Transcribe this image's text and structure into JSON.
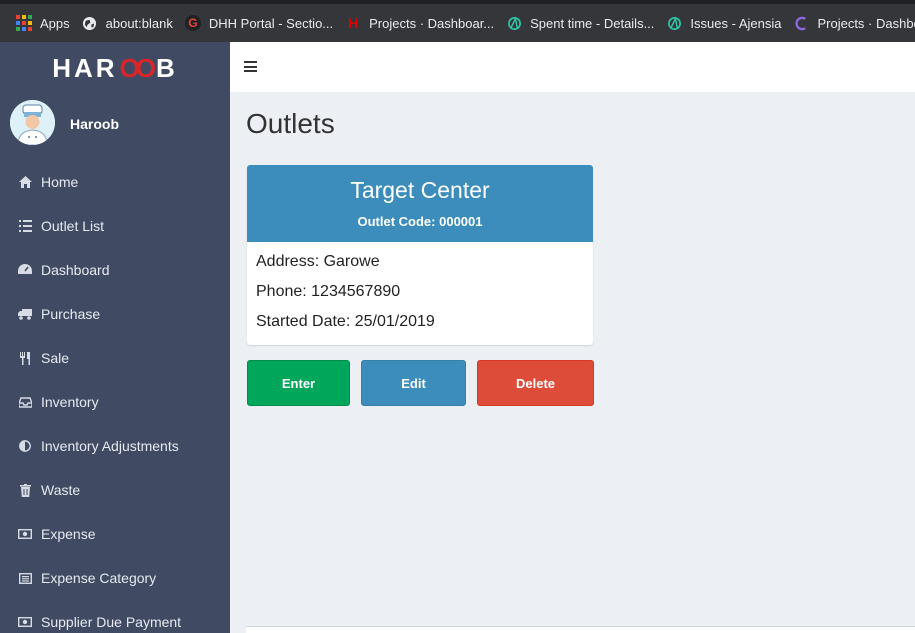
{
  "bookmarks": [
    {
      "icon": "apps-grid-icon",
      "label": "Apps"
    },
    {
      "icon": "globe-icon",
      "label": "about:blank"
    },
    {
      "icon": "g-logo-icon",
      "label": "DHH Portal - Sectio..."
    },
    {
      "icon": "h-logo-icon",
      "label": "Projects · Dashboar..."
    },
    {
      "icon": "ajensia-icon",
      "label": "Spent time - Details..."
    },
    {
      "icon": "ajensia-icon",
      "label": "Issues - Ajensia"
    },
    {
      "icon": "c-logo-icon",
      "label": "Projects · Dashboar..."
    }
  ],
  "brand": {
    "part1": "HAR",
    "part2": "OO",
    "part3": "B",
    "accent": "#d9252a"
  },
  "user": {
    "name": "Haroob"
  },
  "menu": [
    {
      "icon": "home-icon",
      "label": "Home"
    },
    {
      "icon": "list-icon",
      "label": "Outlet List"
    },
    {
      "icon": "dashboard-icon",
      "label": "Dashboard"
    },
    {
      "icon": "truck-icon",
      "label": "Purchase"
    },
    {
      "icon": "cutlery-icon",
      "label": "Sale"
    },
    {
      "icon": "inbox-icon",
      "label": "Inventory"
    },
    {
      "icon": "adjust-icon",
      "label": "Inventory Adjustments"
    },
    {
      "icon": "trash-icon",
      "label": "Waste"
    },
    {
      "icon": "money-icon",
      "label": "Expense"
    },
    {
      "icon": "list-alt-icon",
      "label": "Expense Category"
    },
    {
      "icon": "money-icon",
      "label": "Supplier Due Payment"
    }
  ],
  "page": {
    "title": "Outlets"
  },
  "outlet": {
    "name": "Target Center",
    "code": "Outlet Code: 000001",
    "address": "Address: Garowe",
    "phone": "Phone: 1234567890",
    "started": "Started Date: 25/01/2019"
  },
  "actions": {
    "enter": "Enter",
    "edit": "Edit",
    "delete": "Delete"
  },
  "colors": {
    "sidebar": "#404b63",
    "primary": "#3c8dbc",
    "success": "#00a65a",
    "danger": "#dd4b39"
  }
}
